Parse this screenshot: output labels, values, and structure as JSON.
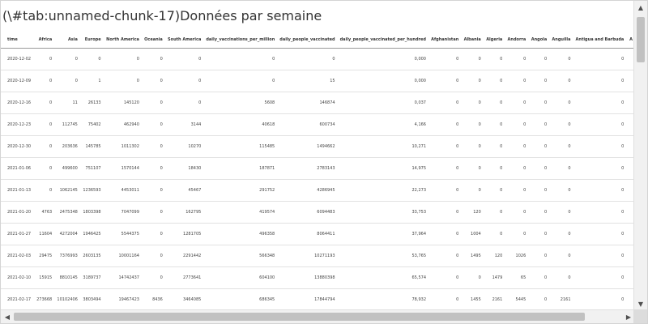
{
  "caption": "(\\#tab:unnamed-chunk-17)Données par semaine",
  "table": {
    "columns": [
      "time",
      "Africa",
      "Asia",
      "Europe",
      "North America",
      "Oceania",
      "South America",
      "daily_vaccinations_per_million",
      "daily_people_vaccinated",
      "daily_people_vaccinated_per_hundred",
      "Afghanistan",
      "Albania",
      "Algeria",
      "Andorra",
      "Angola",
      "Anguilla",
      "Antigua and Barbuda",
      "A"
    ],
    "rows": [
      [
        "2020-12-02",
        "0",
        "0",
        "0",
        "0",
        "0",
        "0",
        "0",
        "0",
        "0,000",
        "0",
        "0",
        "0",
        "0",
        "0",
        "0",
        "0",
        ""
      ],
      [
        "2020-12-09",
        "0",
        "0",
        "1",
        "0",
        "0",
        "0",
        "0",
        "15",
        "0,000",
        "0",
        "0",
        "0",
        "0",
        "0",
        "0",
        "0",
        ""
      ],
      [
        "2020-12-16",
        "0",
        "11",
        "26133",
        "145120",
        "0",
        "0",
        "5608",
        "146874",
        "0,037",
        "0",
        "0",
        "0",
        "0",
        "0",
        "0",
        "0",
        ""
      ],
      [
        "2020-12-23",
        "0",
        "112745",
        "75402",
        "462940",
        "0",
        "3144",
        "40618",
        "600734",
        "4,166",
        "0",
        "0",
        "0",
        "0",
        "0",
        "0",
        "0",
        ""
      ],
      [
        "2020-12-30",
        "0",
        "203636",
        "145785",
        "1011302",
        "0",
        "10270",
        "115485",
        "1494662",
        "10,271",
        "0",
        "0",
        "0",
        "0",
        "0",
        "0",
        "0",
        ""
      ],
      [
        "2021-01-06",
        "0",
        "499600",
        "751107",
        "1570144",
        "0",
        "18430",
        "187871",
        "2783143",
        "14,975",
        "0",
        "0",
        "0",
        "0",
        "0",
        "0",
        "0",
        ""
      ],
      [
        "2021-01-13",
        "0",
        "1062145",
        "1236593",
        "4453011",
        "0",
        "45467",
        "291752",
        "4286945",
        "22,273",
        "0",
        "0",
        "0",
        "0",
        "0",
        "0",
        "0",
        ""
      ],
      [
        "2021-01-20",
        "4763",
        "2475348",
        "1803398",
        "7047099",
        "0",
        "162795",
        "419574",
        "6094483",
        "33,753",
        "0",
        "120",
        "0",
        "0",
        "0",
        "0",
        "0",
        ""
      ],
      [
        "2021-01-27",
        "11604",
        "4272004",
        "1946425",
        "5544375",
        "0",
        "1281705",
        "496358",
        "8064411",
        "37,964",
        "0",
        "1004",
        "0",
        "0",
        "0",
        "0",
        "0",
        ""
      ],
      [
        "2021-02-03",
        "29475",
        "7376993",
        "2603135",
        "10001164",
        "0",
        "2291442",
        "566348",
        "10271193",
        "53,765",
        "0",
        "1495",
        "120",
        "1026",
        "0",
        "0",
        "0",
        ""
      ],
      [
        "2021-02-10",
        "15915",
        "8810145",
        "3189737",
        "14742437",
        "0",
        "2773641",
        "604100",
        "13880398",
        "65,574",
        "0",
        "0",
        "1479",
        "65",
        "0",
        "0",
        "0",
        ""
      ],
      [
        "2021-02-17",
        "273668",
        "10102406",
        "3803494",
        "19467423",
        "8436",
        "3464085",
        "686345",
        "17844794",
        "78,932",
        "0",
        "1455",
        "2161",
        "5445",
        "0",
        "2161",
        "0",
        ""
      ]
    ]
  }
}
